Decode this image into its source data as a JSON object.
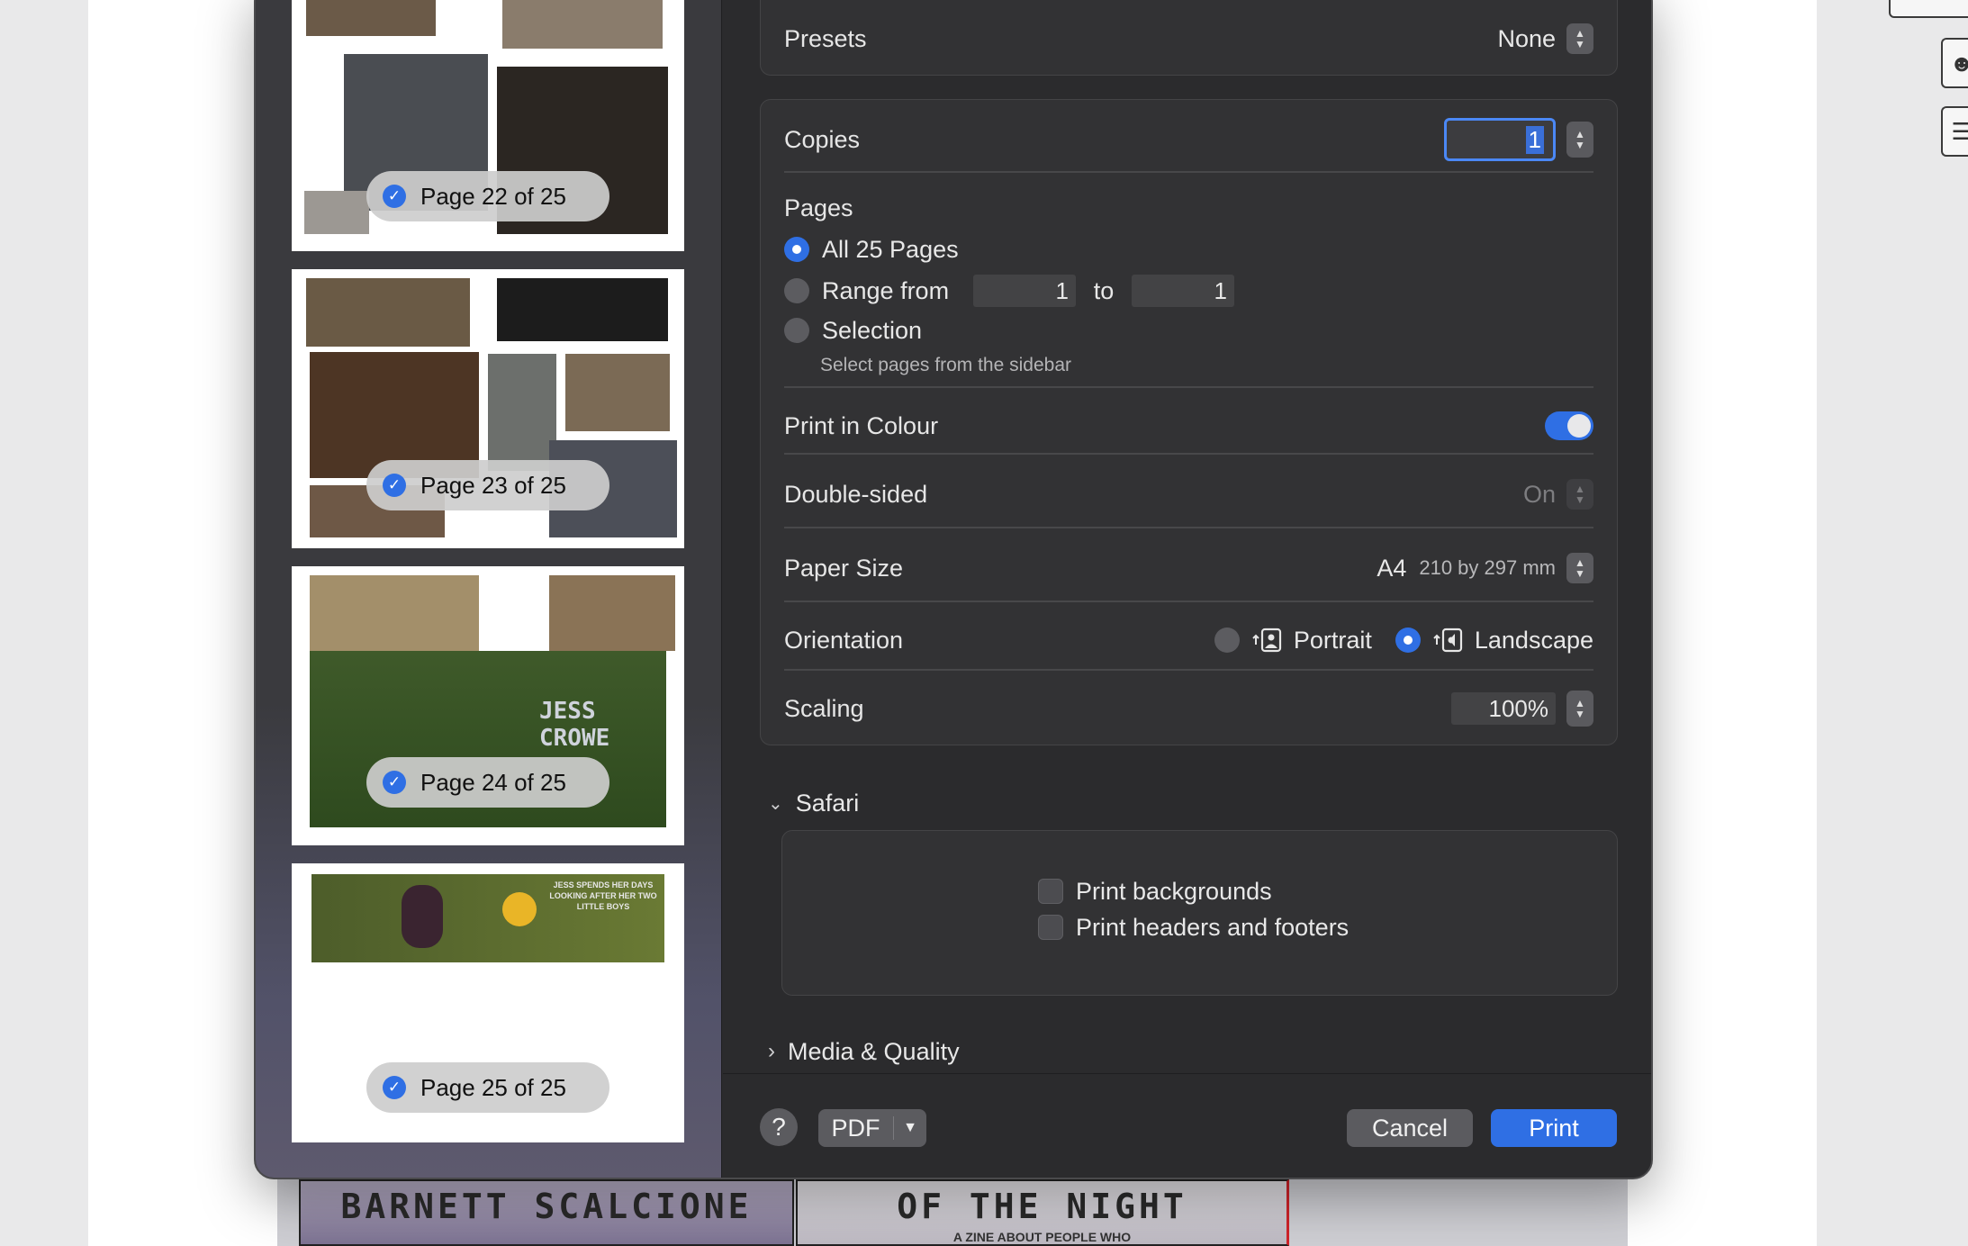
{
  "background": {
    "poster_left_text": "BARNETT SCALCIONE",
    "poster_right_text": "OF THE NIGHT",
    "poster_right_sub": "A ZINE ABOUT PEOPLE WHO"
  },
  "sidebar": {
    "pages": [
      {
        "label": "Page 22 of 25"
      },
      {
        "label": "Page 23 of 25"
      },
      {
        "label": "Page 24 of 25"
      },
      {
        "label": "Page 25 of 25"
      }
    ],
    "page24_graffiti": "JESS CROWE",
    "page25_caption": "JESS SPENDS HER DAYS LOOKING AFTER HER TWO LITTLE BOYS"
  },
  "presets": {
    "label": "Presets",
    "value": "None"
  },
  "copies": {
    "label": "Copies",
    "value": "1"
  },
  "pages": {
    "label": "Pages",
    "all_label": "All 25 Pages",
    "range_label": "Range from",
    "range_from": "1",
    "range_to_label": "to",
    "range_to": "1",
    "selection_label": "Selection",
    "selection_hint": "Select pages from the sidebar",
    "selected": "all"
  },
  "colour": {
    "label": "Print in Colour",
    "on": true
  },
  "double_sided": {
    "label": "Double-sided",
    "value": "On"
  },
  "paper_size": {
    "label": "Paper Size",
    "value": "A4",
    "detail": "210 by 297 mm"
  },
  "orientation": {
    "label": "Orientation",
    "portrait": "Portrait",
    "landscape": "Landscape",
    "selected": "landscape"
  },
  "scaling": {
    "label": "Scaling",
    "value": "100%"
  },
  "safari": {
    "section_label": "Safari",
    "print_backgrounds": "Print backgrounds",
    "print_headers": "Print headers and footers"
  },
  "media_quality": {
    "section_label": "Media & Quality"
  },
  "footer": {
    "help": "?",
    "pdf": "PDF",
    "cancel": "Cancel",
    "print": "Print"
  },
  "colors": {
    "accent": "#2f6fe4",
    "dialog_bg": "#2b2b2d",
    "panel_bg": "#323234"
  }
}
